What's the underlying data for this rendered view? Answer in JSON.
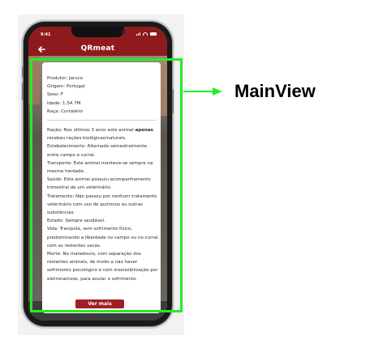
{
  "status_bar": {
    "time": "9:41"
  },
  "app_bar": {
    "back_icon": "arrow-left-icon",
    "title": "QRmeat"
  },
  "details": {
    "produtor": "Produtor: Jaruco",
    "origem": "Origem: Portugal",
    "sexo": "Sexo: F",
    "idade": "Idade: 1.5A 7M",
    "raca": "Raça: Curraleiro"
  },
  "description": {
    "racao_label": "Ração: Nos últimos 3 anos este animal ",
    "racao_bold": "apenas",
    "racao_rest": "recebeu rações biológicas/naturais.",
    "estabelecimento": "Estabelecimento: Alternado semestralmente entre campo e curral.",
    "transporte": "Transporte: Este animal manteve-se sempre na mesma herdade.",
    "saude": "Saúde: Este animal possuiu acompanhamento trimestral de um veterinário.",
    "tratamento": "Tratamento: Não passou por nenhum tratamento veterinário com uso de químicos ou outras substâncias.",
    "estado": "Estado: Sempre saudável.",
    "vida": "Vida: Tranquila, sem sofrimento físico, predominando a liberdade no campo ou no curral, com as restantes vacas.",
    "morte": "Morte: No matadouro, com separação dos restantes animais, de modo a não haver sofrimento psicológico e com insensibilização por eletronarcose, para anular o sofrimento."
  },
  "actions": {
    "more_label": "Ver mais"
  },
  "annotation": {
    "label": "MainView",
    "color": "#22ee22"
  },
  "colors": {
    "brand": "#8e1a1e",
    "button": "#a01f24"
  }
}
